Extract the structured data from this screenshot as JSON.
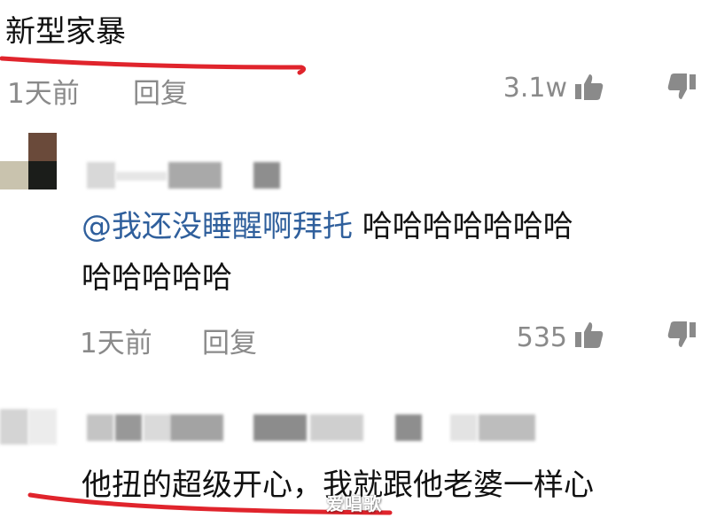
{
  "post": {
    "title": "新型家暴",
    "time": "1天前",
    "reply_label": "回复",
    "like_count": "3.1w"
  },
  "comment1": {
    "mention": "@我还没睡醒啊拜托",
    "text_line1": " 哈哈哈哈哈哈哈",
    "text_line2": "哈哈哈哈哈",
    "time": "1天前",
    "reply_label": "回复",
    "like_count": "535"
  },
  "comment2": {
    "text": "他扭的超级开心，我就跟他老婆一样心"
  },
  "watermark": "爱唱歌",
  "colors": {
    "underline": "#e0242c",
    "mention": "#2f5f9c",
    "meta": "#8a8a8a"
  },
  "icons": [
    "thumbs-up-icon",
    "thumbs-down-icon"
  ]
}
